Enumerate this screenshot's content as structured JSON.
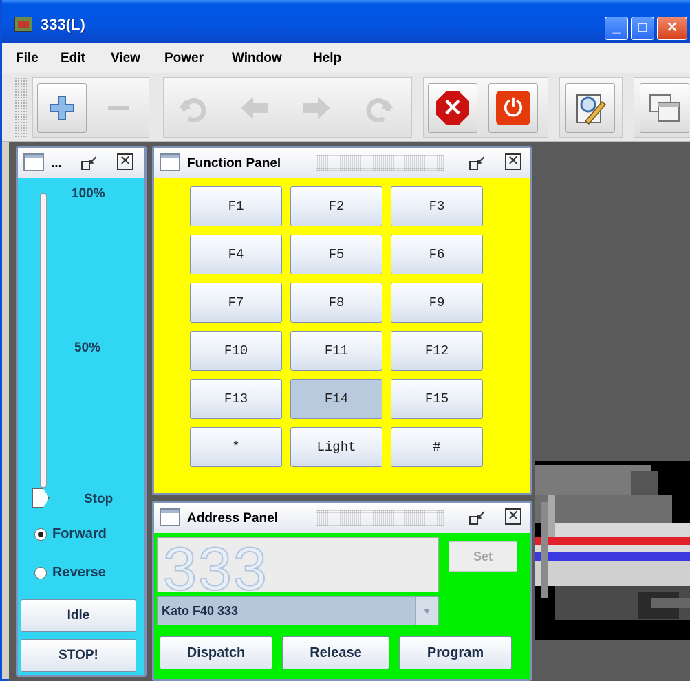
{
  "window": {
    "title": "333(L)"
  },
  "menubar": [
    "File",
    "Edit",
    "View",
    "Power",
    "Window",
    "Help"
  ],
  "throttle": {
    "title": "...",
    "labels": {
      "max": "100%",
      "half": "50%",
      "stop": "Stop"
    },
    "direction": {
      "forward": "Forward",
      "reverse": "Reverse",
      "selected": "forward"
    },
    "buttons": {
      "idle": "Idle",
      "stop": "STOP!"
    },
    "speed_level": 0,
    "background": "#31d7f2"
  },
  "function_panel": {
    "title": "Function Panel",
    "buttons": [
      "F1",
      "F2",
      "F3",
      "F4",
      "F5",
      "F6",
      "F7",
      "F8",
      "F9",
      "F10",
      "F11",
      "F12",
      "F13",
      "F14",
      "F15",
      "*",
      "Light",
      "#"
    ],
    "pressed": "F14",
    "background": "#ffff00"
  },
  "address_panel": {
    "title": "Address Panel",
    "address": "333",
    "set_label": "Set",
    "roster_selected": "Kato F40 333",
    "buttons": {
      "dispatch": "Dispatch",
      "release": "Release",
      "program": "Program"
    },
    "background": "#00f000"
  },
  "toolbar": {
    "icons": [
      "add-icon",
      "remove-icon",
      "undo-icon",
      "back-icon",
      "forward-icon",
      "redo-icon",
      "stop-all-icon",
      "power-icon",
      "preferences-icon",
      "windows-icon"
    ]
  }
}
